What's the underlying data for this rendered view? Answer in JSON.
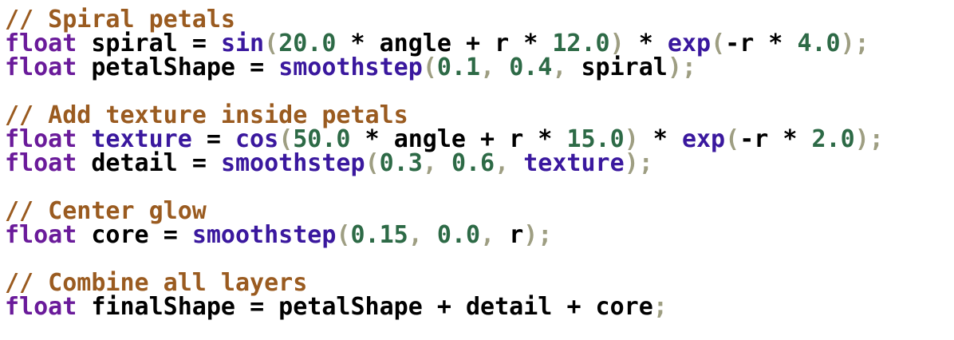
{
  "colors": {
    "comment": "#9a5b20",
    "keyword": "#6a1b9a",
    "function": "#3a189e",
    "number": "#2d6a46",
    "punctuation": "#9e9e82",
    "identifier": "#000000",
    "background": "#ffffff"
  },
  "lines": [
    [
      {
        "t": "comment",
        "v": "// Spiral petals"
      }
    ],
    [
      {
        "t": "keyword",
        "v": "float"
      },
      {
        "t": "ident",
        "v": " spiral "
      },
      {
        "t": "op",
        "v": "="
      },
      {
        "t": "ident",
        "v": " "
      },
      {
        "t": "func",
        "v": "sin"
      },
      {
        "t": "punct",
        "v": "("
      },
      {
        "t": "number",
        "v": "20.0"
      },
      {
        "t": "op",
        "v": " * "
      },
      {
        "t": "ident",
        "v": "angle"
      },
      {
        "t": "op",
        "v": " + "
      },
      {
        "t": "ident",
        "v": "r"
      },
      {
        "t": "op",
        "v": " * "
      },
      {
        "t": "number",
        "v": "12.0"
      },
      {
        "t": "punct",
        "v": ")"
      },
      {
        "t": "op",
        "v": " * "
      },
      {
        "t": "func",
        "v": "exp"
      },
      {
        "t": "punct",
        "v": "("
      },
      {
        "t": "op",
        "v": "-"
      },
      {
        "t": "ident",
        "v": "r"
      },
      {
        "t": "op",
        "v": " * "
      },
      {
        "t": "number",
        "v": "4.0"
      },
      {
        "t": "punct",
        "v": ");"
      }
    ],
    [
      {
        "t": "keyword",
        "v": "float"
      },
      {
        "t": "ident",
        "v": " petalShape "
      },
      {
        "t": "op",
        "v": "="
      },
      {
        "t": "ident",
        "v": " "
      },
      {
        "t": "func",
        "v": "smoothstep"
      },
      {
        "t": "punct",
        "v": "("
      },
      {
        "t": "number",
        "v": "0.1"
      },
      {
        "t": "punct",
        "v": ", "
      },
      {
        "t": "number",
        "v": "0.4"
      },
      {
        "t": "punct",
        "v": ", "
      },
      {
        "t": "ident",
        "v": "spiral"
      },
      {
        "t": "punct",
        "v": ");"
      }
    ],
    [],
    [
      {
        "t": "comment",
        "v": "// Add texture inside petals"
      }
    ],
    [
      {
        "t": "keyword",
        "v": "float"
      },
      {
        "t": "ident",
        "v": " "
      },
      {
        "t": "func",
        "v": "texture"
      },
      {
        "t": "op",
        "v": " = "
      },
      {
        "t": "func",
        "v": "cos"
      },
      {
        "t": "punct",
        "v": "("
      },
      {
        "t": "number",
        "v": "50.0"
      },
      {
        "t": "op",
        "v": " * "
      },
      {
        "t": "ident",
        "v": "angle"
      },
      {
        "t": "op",
        "v": " + "
      },
      {
        "t": "ident",
        "v": "r"
      },
      {
        "t": "op",
        "v": " * "
      },
      {
        "t": "number",
        "v": "15.0"
      },
      {
        "t": "punct",
        "v": ")"
      },
      {
        "t": "op",
        "v": " * "
      },
      {
        "t": "func",
        "v": "exp"
      },
      {
        "t": "punct",
        "v": "("
      },
      {
        "t": "op",
        "v": "-"
      },
      {
        "t": "ident",
        "v": "r"
      },
      {
        "t": "op",
        "v": " * "
      },
      {
        "t": "number",
        "v": "2.0"
      },
      {
        "t": "punct",
        "v": ");"
      }
    ],
    [
      {
        "t": "keyword",
        "v": "float"
      },
      {
        "t": "ident",
        "v": " detail "
      },
      {
        "t": "op",
        "v": "="
      },
      {
        "t": "ident",
        "v": " "
      },
      {
        "t": "func",
        "v": "smoothstep"
      },
      {
        "t": "punct",
        "v": "("
      },
      {
        "t": "number",
        "v": "0.3"
      },
      {
        "t": "punct",
        "v": ", "
      },
      {
        "t": "number",
        "v": "0.6"
      },
      {
        "t": "punct",
        "v": ", "
      },
      {
        "t": "func",
        "v": "texture"
      },
      {
        "t": "punct",
        "v": ");"
      }
    ],
    [],
    [
      {
        "t": "comment",
        "v": "// Center glow"
      }
    ],
    [
      {
        "t": "keyword",
        "v": "float"
      },
      {
        "t": "ident",
        "v": " core "
      },
      {
        "t": "op",
        "v": "="
      },
      {
        "t": "ident",
        "v": " "
      },
      {
        "t": "func",
        "v": "smoothstep"
      },
      {
        "t": "punct",
        "v": "("
      },
      {
        "t": "number",
        "v": "0.15"
      },
      {
        "t": "punct",
        "v": ", "
      },
      {
        "t": "number",
        "v": "0.0"
      },
      {
        "t": "punct",
        "v": ", "
      },
      {
        "t": "ident",
        "v": "r"
      },
      {
        "t": "punct",
        "v": ");"
      }
    ],
    [],
    [
      {
        "t": "comment",
        "v": "// Combine all layers"
      }
    ],
    [
      {
        "t": "keyword",
        "v": "float"
      },
      {
        "t": "ident",
        "v": " finalShape "
      },
      {
        "t": "op",
        "v": "="
      },
      {
        "t": "ident",
        "v": " petalShape "
      },
      {
        "t": "op",
        "v": "+"
      },
      {
        "t": "ident",
        "v": " detail "
      },
      {
        "t": "op",
        "v": "+"
      },
      {
        "t": "ident",
        "v": " core"
      },
      {
        "t": "punct",
        "v": ";"
      }
    ]
  ]
}
